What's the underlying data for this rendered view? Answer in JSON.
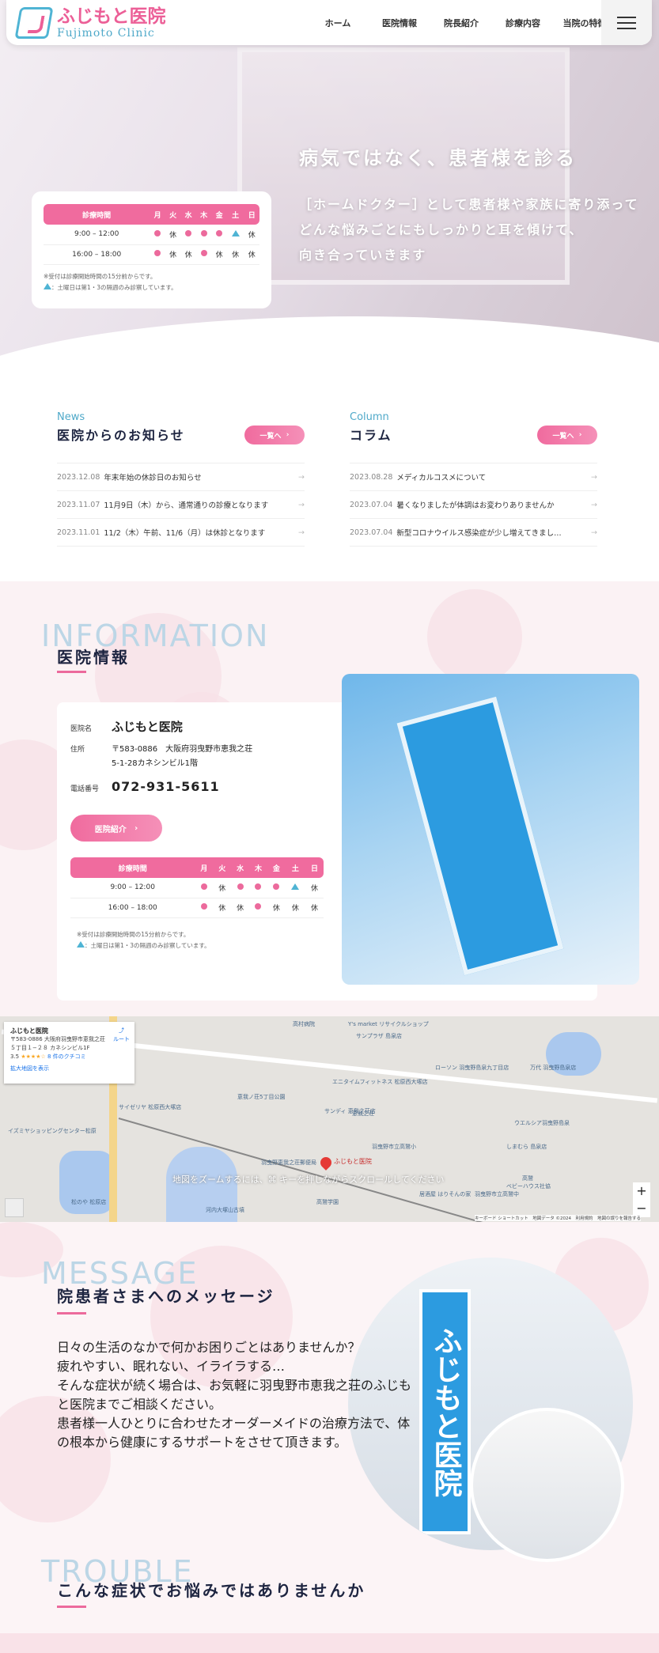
{
  "header": {
    "logo_jp": "ふじもと医院",
    "logo_en": "Fujimoto Clinic",
    "nav": [
      "ホーム",
      "医院情報",
      "院長紹介",
      "診療内容",
      "当院の特徴"
    ]
  },
  "hero": {
    "headline": "病気ではなく、患者様を診る",
    "lines": [
      "［ホームドクター］として患者様や家族に寄り添って",
      "どんな悩みごとにもしっかりと耳を傾けて、",
      "向き合っていきます"
    ]
  },
  "schedule": {
    "header": [
      "診療時間",
      "月",
      "火",
      "水",
      "木",
      "金",
      "土",
      "日"
    ],
    "rows": [
      {
        "time": "9:00 – 12:00",
        "cells": [
          "dot",
          "休",
          "dot",
          "dot",
          "dot",
          "tri",
          "休"
        ]
      },
      {
        "time": "16:00 – 18:00",
        "cells": [
          "dot",
          "休",
          "休",
          "dot",
          "休",
          "休",
          "休"
        ]
      }
    ],
    "note1": "※受付は診療開始時間の15分前からです。",
    "note2": "：土曜日は第1・3の隔週のみ診察しています。"
  },
  "news": {
    "en": "News",
    "title": "医院からのお知らせ",
    "more": "一覧へ",
    "items": [
      {
        "date": "2023.12.08",
        "text": "年末年始の休診日のお知らせ"
      },
      {
        "date": "2023.11.07",
        "text": "11月9日（木）から、通常通りの診療となります"
      },
      {
        "date": "2023.11.01",
        "text": "11/2（木）午前、11/6（月）は休診となります"
      }
    ]
  },
  "column": {
    "en": "Column",
    "title": "コラム",
    "more": "一覧へ",
    "items": [
      {
        "date": "2023.08.28",
        "text": "メディカルコスメについて"
      },
      {
        "date": "2023.07.04",
        "text": "暑くなりましたが体調はお変わりありませんか"
      },
      {
        "date": "2023.07.04",
        "text": "新型コロナウイルス感染症が少し増えてきまし…"
      }
    ]
  },
  "info": {
    "bg_word": "INFORMATION",
    "title": "医院情報",
    "name_label": "医院名",
    "name": "ふじもと医院",
    "addr_label": "住所",
    "addr1": "〒583-0886　大阪府羽曳野市恵我之荘",
    "addr2": "5-1-28カネシンビル1階",
    "tel_label": "電話番号",
    "tel": "072-931-5611",
    "button": "医院紹介",
    "sign_text": "ふじもと医院"
  },
  "map": {
    "place": "ふじもと医院",
    "address1": "〒583-0886 大阪府羽曳野市恵我之荘",
    "address2": "５丁目１−２８ カネシンビル1F",
    "rating": "3.5",
    "stars": "★★★★☆",
    "reviews": "8 件のクチコミ",
    "route": "ルート",
    "larger": "拡大地図を表示",
    "hint": "地図をズームするには、⌘ キーを押しながらスクロールしてください",
    "pin_label": "ふじもと医院",
    "labels": [
      "Y's market リサイクルショップ",
      "高村病院",
      "サンプラザ 島泉店",
      "ローソン 羽曳野島泉九丁目店",
      "万代 羽曳野島泉店",
      "エニタイムフィットネス 松原西大塚店",
      "サンディ 恵我之荘店",
      "恵我ノ荘5丁目公園",
      "恵我之荘",
      "イズミヤショッピングセンター松原",
      "サイゼリヤ 松原西大塚店",
      "ウエルシア羽曳野島泉",
      "しまむら 島泉店",
      "羽曳野市立高鷲小",
      "河内大塚山古墳",
      "羽曳野市立高鷲中",
      "松のや 松原店",
      "羽曳野恵我之荘郵便局",
      "高鷲学園",
      "居酒屋 はりそんの家",
      "ベビーハウス社協",
      "高鷲"
    ],
    "footer": "キーボード ショートカット　地図データ ©2024　利用規約　地図の誤りを報告する",
    "zoom_in": "+",
    "zoom_out": "−"
  },
  "message": {
    "bg_word": "MESSAGE",
    "title": "院患者さまへのメッセージ",
    "lines": [
      "日々の生活のなかで何かお困りごとはありませんか？",
      "疲れやすい、眠れない、イライラする…",
      "そんな症状が続く場合は、お気軽に羽曳野市恵我之荘のふじも",
      "と医院までご相談ください。",
      "患者様一人ひとりに合わせたオーダーメイドの治療方法で、体",
      "の根本から健康にするサポートをさせて頂きます。"
    ]
  },
  "trouble": {
    "bg_word": "TROUBLE",
    "title": "こんな症状でお悩みではありませんか"
  },
  "colors": {
    "pink": "#ec6a9c",
    "blue": "#4fa9c9",
    "navy": "#1d2440"
  }
}
